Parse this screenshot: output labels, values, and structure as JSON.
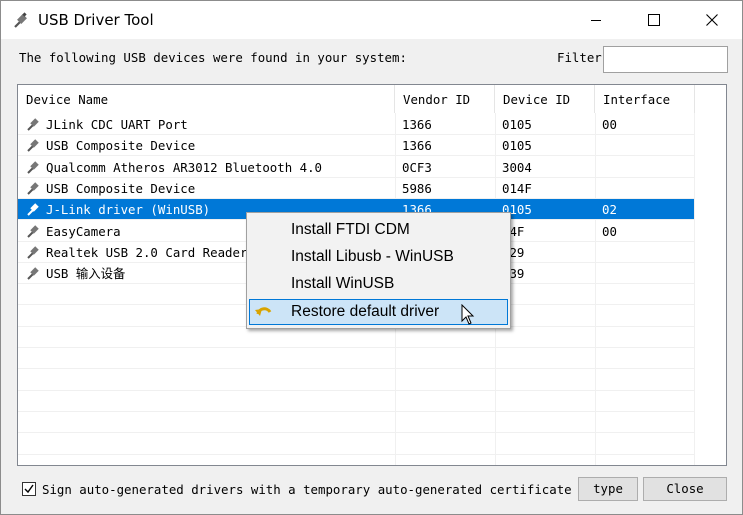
{
  "window": {
    "title": "USB Driver Tool",
    "controls": {
      "minimize": "minimize-icon",
      "maximize": "maximize-icon",
      "close": "close-icon"
    }
  },
  "top": {
    "found_label": "The following USB devices were found in your system:",
    "filter_label": "Filter",
    "filter_value": ""
  },
  "table": {
    "columns": [
      "Device Name",
      "Vendor ID",
      "Device ID",
      "Interface"
    ],
    "rows": [
      {
        "name": "JLink CDC UART Port",
        "vendor": "1366",
        "device": "0105",
        "interface": "00"
      },
      {
        "name": "USB Composite Device",
        "vendor": "1366",
        "device": "0105",
        "interface": ""
      },
      {
        "name": "Qualcomm Atheros AR3012 Bluetooth 4.0",
        "vendor": "0CF3",
        "device": "3004",
        "interface": ""
      },
      {
        "name": "USB Composite Device",
        "vendor": "5986",
        "device": "014F",
        "interface": ""
      },
      {
        "name": "J-Link driver (WinUSB)",
        "vendor": "1366",
        "device": "0105",
        "interface": "02"
      },
      {
        "name": "EasyCamera",
        "vendor": "",
        "device": "14F",
        "interface": "00"
      },
      {
        "name": "Realtek USB 2.0 Card Reader",
        "vendor": "",
        "device": "129",
        "interface": ""
      },
      {
        "name": "USB 输入设备",
        "vendor": "",
        "device": "039",
        "interface": ""
      }
    ],
    "selected_index": 4
  },
  "context_menu": {
    "items": [
      "Install FTDI CDM",
      "Install Libusb - WinUSB",
      "Install WinUSB",
      "Restore default driver"
    ],
    "hover_index": 3
  },
  "bottom": {
    "checkbox_checked": true,
    "checkbox_label": "Sign auto-generated drivers with a temporary auto-generated certificate",
    "type_button": "type",
    "close_button": "Close"
  },
  "colors": {
    "selection": "#0078d7",
    "menu_hover": "#cce4f7"
  }
}
